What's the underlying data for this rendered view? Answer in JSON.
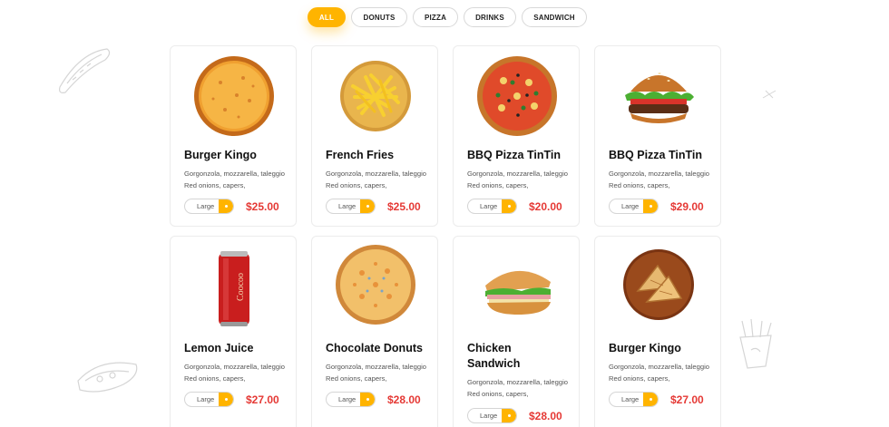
{
  "filters": [
    {
      "label": "ALL",
      "active": true
    },
    {
      "label": "DONUTS",
      "active": false
    },
    {
      "label": "PIZZA",
      "active": false
    },
    {
      "label": "DRINKS",
      "active": false
    },
    {
      "label": "SANDWICH",
      "active": false
    }
  ],
  "accent_color": "#ffb400",
  "price_color": "#e53935",
  "products": [
    {
      "name": "Burger Kingo",
      "desc": "Gorgonzola, mozzarella, taleggio Red onions, capers,",
      "size": "Large",
      "price": "$25.00",
      "icon": "cheese-pizza-image"
    },
    {
      "name": "French Fries",
      "desc": "Gorgonzola, mozzarella, taleggio Red onions, capers,",
      "size": "Large",
      "price": "$25.00",
      "icon": "french-fries-image"
    },
    {
      "name": "BBQ Pizza TinTin",
      "desc": "Gorgonzola, mozzarella, taleggio Red onions, capers,",
      "size": "Large",
      "price": "$20.00",
      "icon": "bbq-pizza-image"
    },
    {
      "name": "BBQ Pizza TinTin",
      "desc": "Gorgonzola, mozzarella, taleggio Red onions, capers,",
      "size": "Large",
      "price": "$29.00",
      "icon": "burger-image"
    },
    {
      "name": "Lemon Juice",
      "desc": "Gorgonzola, mozzarella, taleggio Red onions, capers,",
      "size": "Large",
      "price": "$27.00",
      "icon": "soda-can-image",
      "can_text": "Coocoo"
    },
    {
      "name": "Chocolate Donuts",
      "desc": "Gorgonzola, mozzarella, taleggio Red onions, capers,",
      "size": "Large",
      "price": "$28.00",
      "icon": "pizza-image"
    },
    {
      "name": "Chicken Sandwich",
      "desc": "Gorgonzola, mozzarella, taleggio Red onions, capers,",
      "size": "Large",
      "price": "$28.00",
      "icon": "sandwich-image"
    },
    {
      "name": "Burger Kingo",
      "desc": "Gorgonzola, mozzarella, taleggio Red onions, capers,",
      "size": "Large",
      "price": "$27.00",
      "icon": "toasted-sandwich-image"
    }
  ]
}
